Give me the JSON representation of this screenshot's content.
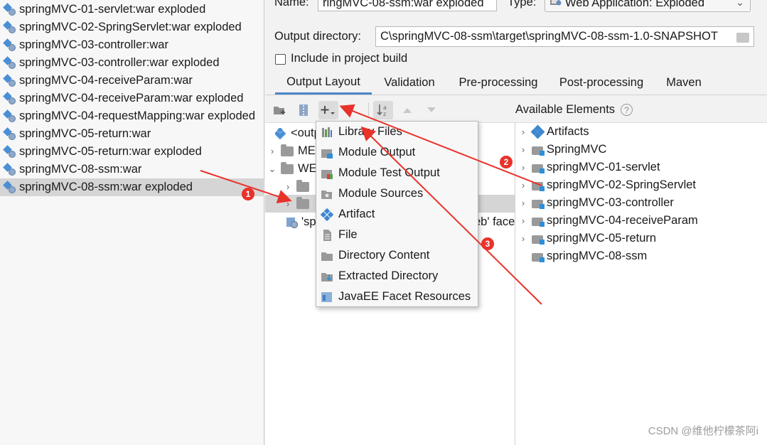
{
  "artifacts": [
    {
      "label": "springMVC-01-servlet:war exploded"
    },
    {
      "label": "springMVC-02-SpringServlet:war exploded"
    },
    {
      "label": "springMVC-03-controller:war"
    },
    {
      "label": "springMVC-03-controller:war exploded"
    },
    {
      "label": "springMVC-04-receiveParam:war"
    },
    {
      "label": "springMVC-04-receiveParam:war exploded"
    },
    {
      "label": "springMVC-04-requestMapping:war exploded"
    },
    {
      "label": "springMVC-05-return:war"
    },
    {
      "label": "springMVC-05-return:war exploded"
    },
    {
      "label": "springMVC-08-ssm:war"
    },
    {
      "label": "springMVC-08-ssm:war exploded"
    }
  ],
  "form": {
    "name_label": "Name:",
    "name_value": "ringMVC-08-ssm:war exploded",
    "type_label": "Type:",
    "type_value": "Web Application: Exploded",
    "output_dir_label": "Output directory:",
    "output_dir_value": "C\\springMVC-08-ssm\\target\\springMVC-08-ssm-1.0-SNAPSHOT",
    "include_label": "Include in project build"
  },
  "tabs": [
    "Output Layout",
    "Validation",
    "Pre-processing",
    "Post-processing",
    "Maven"
  ],
  "available_title": "Available Elements",
  "tree": {
    "root": "<outp",
    "meta": "ME",
    "web": "WE",
    "facet": "'sp",
    "facet_tail": "eb' face"
  },
  "menu_items": [
    "Library Files",
    "Module Output",
    "Module Test Output",
    "Module Sources",
    "Artifact",
    "File",
    "Directory Content",
    "Extracted Directory",
    "JavaEE Facet Resources"
  ],
  "available_elements": [
    {
      "label": "Artifacts",
      "icon": "artifact-icon"
    },
    {
      "label": "SpringMVC",
      "icon": "module-icon"
    },
    {
      "label": "springMVC-01-servlet",
      "icon": "module-icon"
    },
    {
      "label": "springMVC-02-SpringServlet",
      "icon": "module-icon"
    },
    {
      "label": "springMVC-03-controller",
      "icon": "module-icon"
    },
    {
      "label": "springMVC-04-receiveParam",
      "icon": "module-icon"
    },
    {
      "label": "springMVC-05-return",
      "icon": "module-icon"
    },
    {
      "label": "springMVC-08-ssm",
      "icon": "module-icon"
    }
  ],
  "annotations": [
    "1",
    "2",
    "3"
  ],
  "colors": {
    "annotation_red": "#e8322a",
    "selection": "#d5d5d5",
    "accent_blue": "#4a88c7"
  },
  "watermark": "CSDN @维他柠檬茶阿i"
}
